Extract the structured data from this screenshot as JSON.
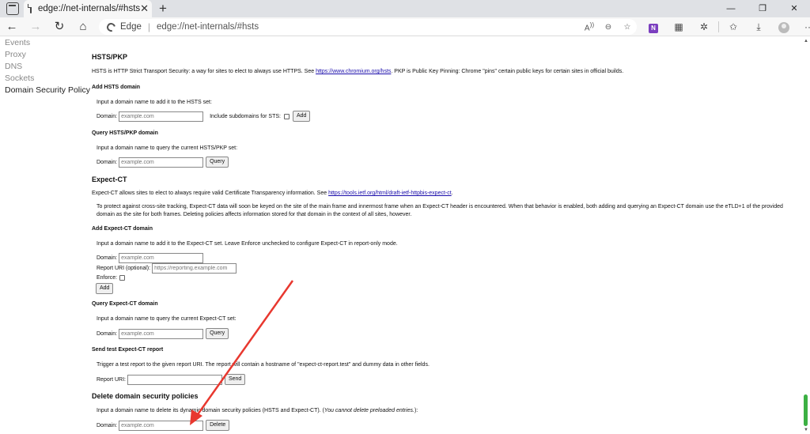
{
  "browser": {
    "tab_title": "edge://net-internals/#hsts",
    "omnibox_brand": "Edge",
    "omnibox_url": "edge://net-internals/#hsts"
  },
  "sidebar": {
    "items": [
      {
        "label": "Events"
      },
      {
        "label": "Proxy"
      },
      {
        "label": "DNS"
      },
      {
        "label": "Sockets"
      },
      {
        "label": "Domain Security Policy"
      }
    ]
  },
  "hsts": {
    "title": "HSTS/PKP",
    "desc_pre": "HSTS is HTTP Strict Transport Security: a way for sites to elect to always use HTTPS. See ",
    "desc_link": "https://www.chromium.org/hsts",
    "desc_post": ". PKP is Public Key Pinning: Chrome \"pins\" certain public keys for certain sites in official builds.",
    "add": {
      "title": "Add HSTS domain",
      "desc": "Input a domain name to add it to the HSTS set:",
      "domain_label": "Domain:",
      "domain_placeholder": "example.com",
      "subdomains_label": "Include subdomains for STS:",
      "button": "Add"
    },
    "query": {
      "title": "Query HSTS/PKP domain",
      "desc": "Input a domain name to query the current HSTS/PKP set:",
      "domain_label": "Domain:",
      "domain_placeholder": "example.com",
      "button": "Query"
    }
  },
  "expect_ct": {
    "title": "Expect-CT",
    "desc_pre": "Expect-CT allows sites to elect to always require valid Certificate Transparency information. See ",
    "desc_link": "https://tools.ietf.org/html/draft-ietf-httpbis-expect-ct",
    "desc_post": ".",
    "note": "To protect against cross-site tracking, Expect-CT data will soon be keyed on the site of the main frame and innermost frame when an Expect-CT header is encountered. When that behavior is enabled, both adding and querying an Expect-CT domain use the eTLD+1 of the provided domain as the site for both frames. Deleting policies affects information stored for that domain in the context of all sites, however.",
    "add": {
      "title": "Add Expect-CT domain",
      "desc": "Input a domain name to add it to the Expect-CT set. Leave Enforce unchecked to configure Expect-CT in report-only mode.",
      "domain_label": "Domain:",
      "domain_placeholder": "example.com",
      "report_label": "Report URI (optional):",
      "report_placeholder": "https://reporting.example.com",
      "enforce_label": "Enforce:",
      "button": "Add"
    },
    "query": {
      "title": "Query Expect-CT domain",
      "desc": "Input a domain name to query the current Expect-CT set:",
      "domain_label": "Domain:",
      "domain_placeholder": "example.com",
      "button": "Query"
    },
    "test": {
      "title": "Send test Expect-CT report",
      "desc": "Trigger a test report to the given report URI. The report will contain a hostname of \"expect-ct-report.test\" and dummy data in other fields.",
      "report_label": "Report URI:",
      "button": "Send"
    }
  },
  "delete": {
    "title": "Delete domain security policies",
    "desc_pre": "Input a domain name to delete its dynamic domain security policies (HSTS and Expect-CT). (",
    "desc_em": "You cannot delete preloaded entries.",
    "desc_post": "):",
    "domain_label": "Domain:",
    "domain_placeholder": "example.com",
    "button": "Delete"
  },
  "colors": {
    "arrow": "#e8382f",
    "link": "#1a0dab",
    "scroll_thumb": "#3cb043",
    "edge_icon": "#7b3fbf"
  }
}
